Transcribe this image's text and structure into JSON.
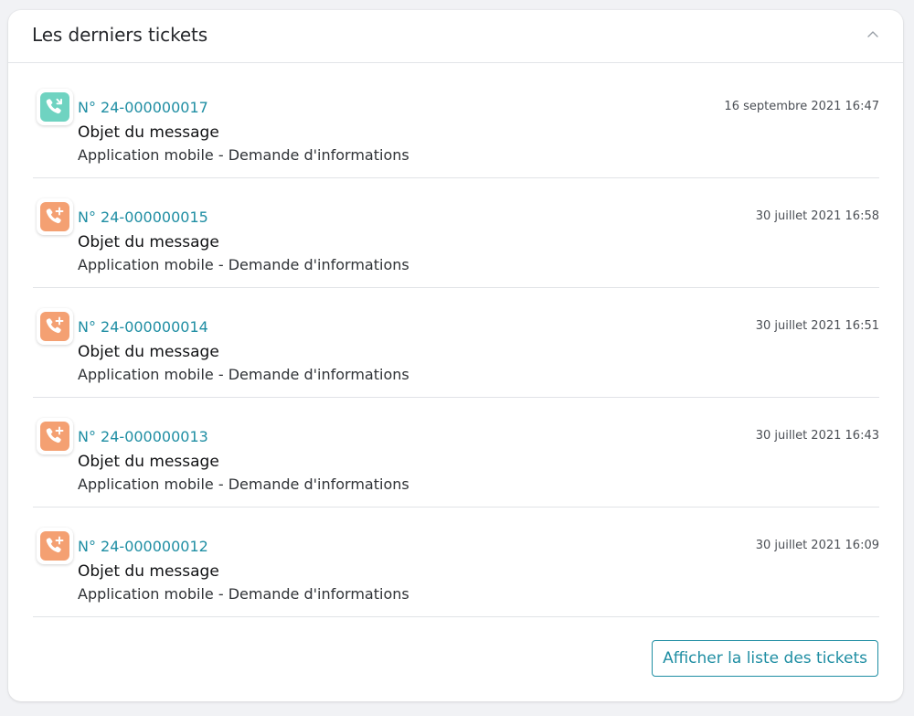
{
  "panel": {
    "title": "Les derniers tickets",
    "collapse_icon": "chevron-up-icon"
  },
  "colors": {
    "accent": "#1f8ea3",
    "status_teal": "#6fd3c1",
    "status_orange": "#f4a072"
  },
  "tickets": [
    {
      "number": "N° 24-000000017",
      "subject": "Objet du message",
      "category": "Application mobile - Demande d'informations",
      "date": "16 septembre 2021 16:47",
      "icon": "phone-arrow-icon",
      "icon_color": "#6fd3c1"
    },
    {
      "number": "N° 24-000000015",
      "subject": "Objet du message",
      "category": "Application mobile - Demande d'informations",
      "date": "30 juillet 2021 16:58",
      "icon": "phone-plus-icon",
      "icon_color": "#f4a072"
    },
    {
      "number": "N° 24-000000014",
      "subject": "Objet du message",
      "category": "Application mobile - Demande d'informations",
      "date": "30 juillet 2021 16:51",
      "icon": "phone-plus-icon",
      "icon_color": "#f4a072"
    },
    {
      "number": "N° 24-000000013",
      "subject": "Objet du message",
      "category": "Application mobile - Demande d'informations",
      "date": "30 juillet 2021 16:43",
      "icon": "phone-plus-icon",
      "icon_color": "#f4a072"
    },
    {
      "number": "N° 24-000000012",
      "subject": "Objet du message",
      "category": "Application mobile - Demande d'informations",
      "date": "30 juillet 2021 16:09",
      "icon": "phone-plus-icon",
      "icon_color": "#f4a072"
    }
  ],
  "footer": {
    "list_button_label": "Afficher la liste des tickets"
  }
}
